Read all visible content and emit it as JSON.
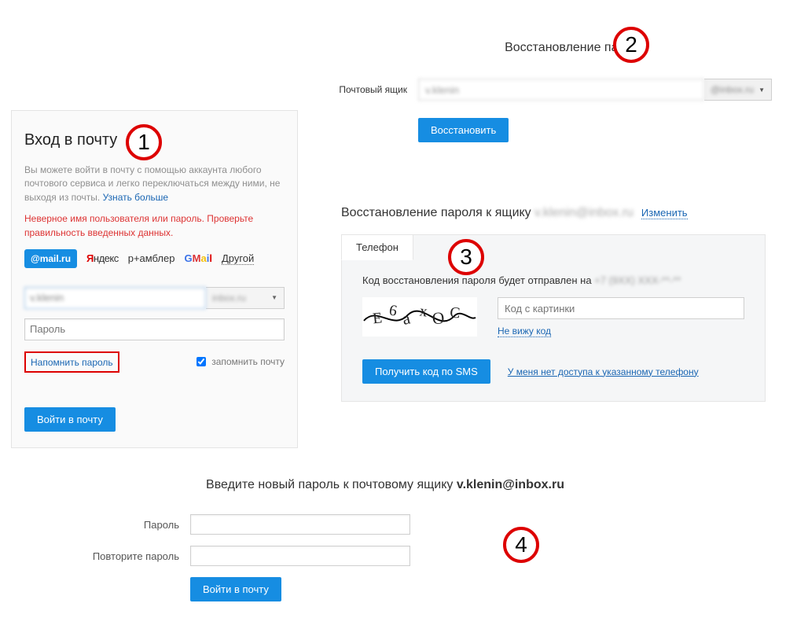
{
  "step_numbers": {
    "s1": "1",
    "s2": "2",
    "s3": "3",
    "s4": "4"
  },
  "login": {
    "title": "Вход в почту",
    "desc_before": "Вы можете войти в почту с помощью аккаунта любого почтового сервиса и легко переключаться между ними, не выходя из почты. ",
    "desc_link": "Узнать больше",
    "error": "Неверное имя пользователя или пароль. Проверьте правильность введенных данных.",
    "providers": {
      "mail": "@mail.ru",
      "yandex_y": "Я",
      "yandex_rest": "ндекс",
      "rambler": "р+амблер",
      "gmail": "GMail",
      "other": "Другой"
    },
    "email_value": "v.klenin",
    "domain_value": "inbox.ru",
    "password_placeholder": "Пароль",
    "remind_label": "Напомнить пароль",
    "remember_label": "запомнить почту",
    "submit": "Войти в почту"
  },
  "recover": {
    "title": "Восстановление пароля",
    "mailbox_label": "Почтовый ящик",
    "email_value": "v.klenin",
    "domain_value": "@inbox.ru",
    "submit": "Восстановить"
  },
  "phone": {
    "header_prefix": "Восстановление пароля к ящику",
    "header_email": "v.klenin@inbox.ru",
    "change": "Изменить",
    "tab": "Телефон",
    "sent_prefix": "Код восстановления пароля будет отправлен на ",
    "sent_phone": "+7 (9XX) XXX-**-**",
    "captcha_placeholder": "Код с картинки",
    "captcha_link": "Не вижу код",
    "sms_button": "Получить код по SMS",
    "noaccess": "У меня нет доступа к указанному телефону"
  },
  "newpw": {
    "title_prefix": "Введите новый пароль к почтовому ящику ",
    "title_email": "v.klenin@inbox.ru",
    "label_pw": "Пароль",
    "label_pw2": "Повторите пароль",
    "submit": "Войти в почту"
  }
}
